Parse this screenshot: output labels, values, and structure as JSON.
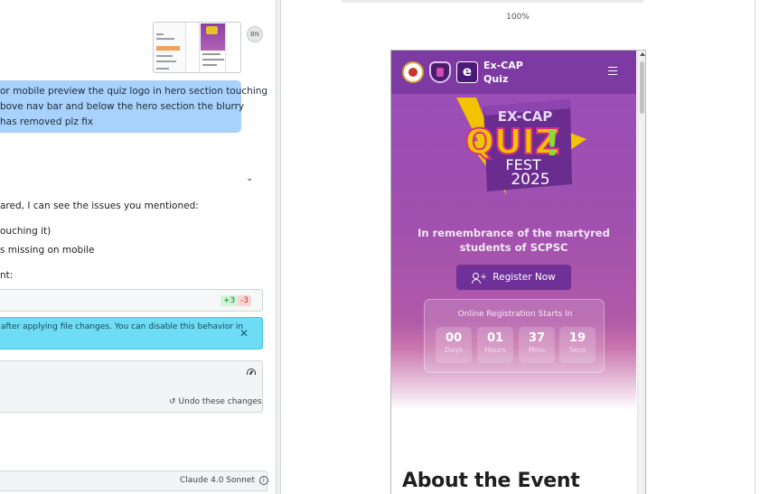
{
  "chat": {
    "user_avatar": "BN",
    "user_message_lines": [
      "or mobile preview the quiz logo in hero section touching",
      "bove nav bar and below the hero section the blurry",
      "has removed plz fix"
    ],
    "assistant_lines": [
      "ared, I can see the issues you mentioned:",
      "ouching it)",
      "s missing on mobile",
      "nt:"
    ],
    "diff_added": "+3",
    "diff_removed": "-3",
    "info_banner": "after applying file changes. You can disable this behavior in",
    "undo_label": "Undo these changes",
    "model_label": "Claude 4.0 Sonnet"
  },
  "preview": {
    "zoom": "100%",
    "brand_line1": "Ex-CAP",
    "brand_line2": "Quiz",
    "logo_letter": "e",
    "hero_logo": {
      "top": "EX-CAP",
      "main": "QUIZ",
      "exclaim": "!",
      "sub1": "FEST",
      "sub2": "2025"
    },
    "tagline_line1": "In remembrance of the martyred",
    "tagline_line2": "students of SCPSC",
    "register_label": "Register Now",
    "countdown_title": "Online Registration Starts In",
    "countdown": [
      {
        "value": "00",
        "unit": "Days"
      },
      {
        "value": "01",
        "unit": "Hours"
      },
      {
        "value": "37",
        "unit": "Mins"
      },
      {
        "value": "19",
        "unit": "Secs"
      }
    ],
    "about_heading": "About the Event"
  },
  "colors": {
    "nav": "#7d3aa3",
    "hero_top": "#9a4eb6",
    "register_button": "#6f3098",
    "user_bubble": "#a8d2fb",
    "info_banner": "#6fdcf5"
  }
}
